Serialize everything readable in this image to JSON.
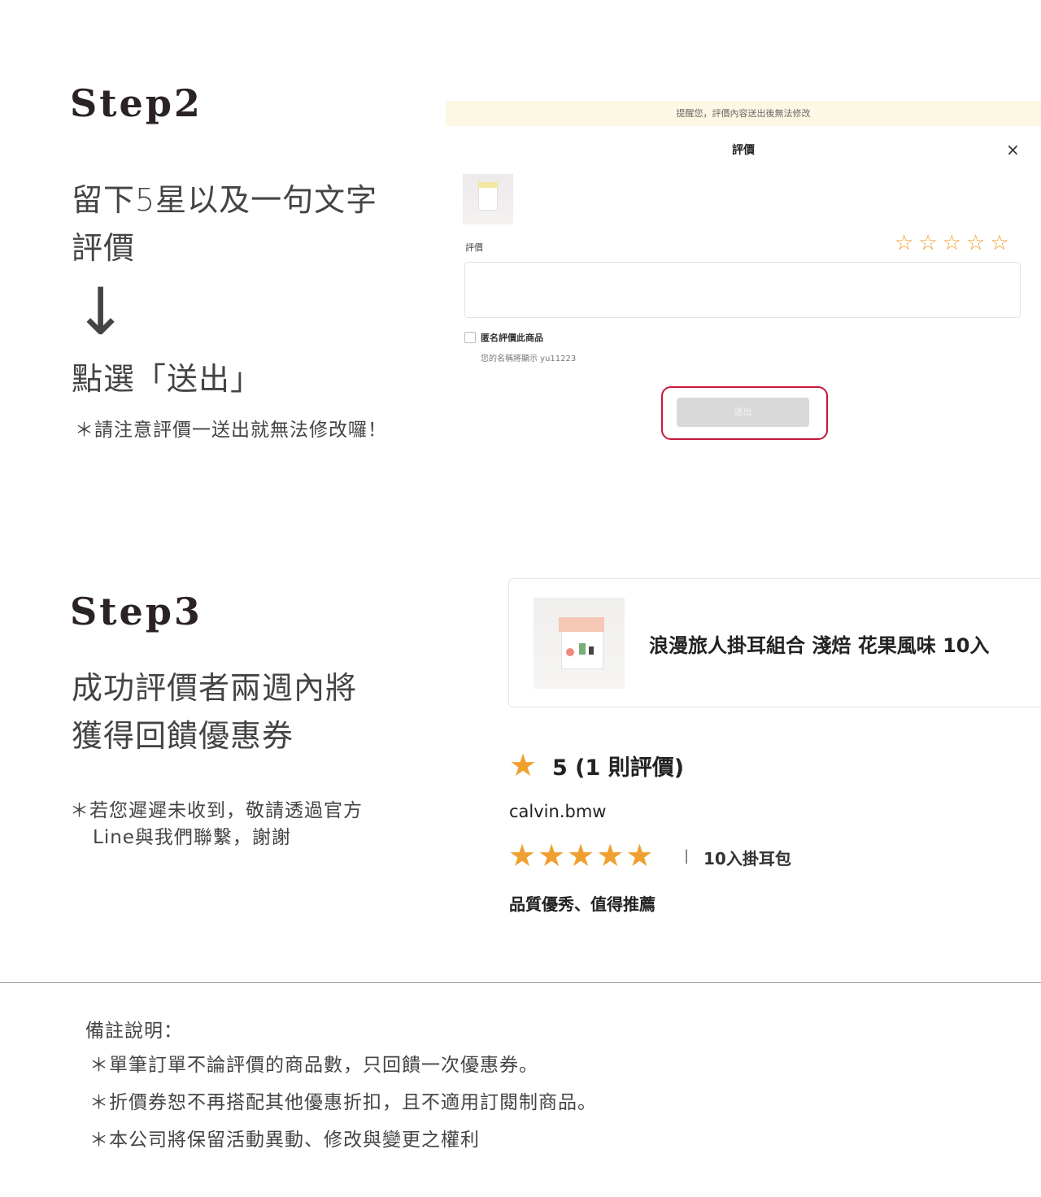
{
  "step2": {
    "title": "Step2",
    "line1": "留下5星以及一句文字",
    "line2": "評價",
    "arrow": "↓",
    "line3": "點選「送出」",
    "note": "＊請注意評價一送出就無法修改囉！"
  },
  "modal": {
    "banner": "提醒您，評價內容送出後無法修改",
    "title": "評價",
    "close_icon": "×",
    "rating_label": "評價",
    "stars": [
      "☆",
      "☆",
      "☆",
      "☆",
      "☆"
    ],
    "anonymous_label": "匿名評價此商品",
    "anonymous_sub": "您的名稱將顯示 yu11223",
    "submit_label": "送出",
    "highlight_color": "#c8163a"
  },
  "step3": {
    "title": "Step3",
    "line1": "成功評價者兩週內將",
    "line2": "獲得回饋優惠券",
    "note1": "＊若您遲遲未收到，敬請透過官方",
    "note2": "Line與我們聯繫，謝謝"
  },
  "review": {
    "product_name": "浪漫旅人掛耳組合 淺焙 花果風味 10入",
    "avg_star": "★",
    "avg_text": "5 (1 則評價)",
    "reviewer": "calvin.bmw",
    "stars": [
      "★",
      "★",
      "★",
      "★",
      "★"
    ],
    "rating_value": 5,
    "separator": "|",
    "variant": "10入掛耳包",
    "body": "品質優秀、值得推薦",
    "star_color": "#f0a030"
  },
  "remarks": {
    "title": "備註說明：",
    "items": [
      "＊單筆訂單不論評價的商品數，只回饋一次優惠券。",
      "＊折價券恕不再搭配其他優惠折扣，且不適用訂閱制商品。",
      "＊本公司將保留活動異動、修改與變更之權利"
    ]
  }
}
